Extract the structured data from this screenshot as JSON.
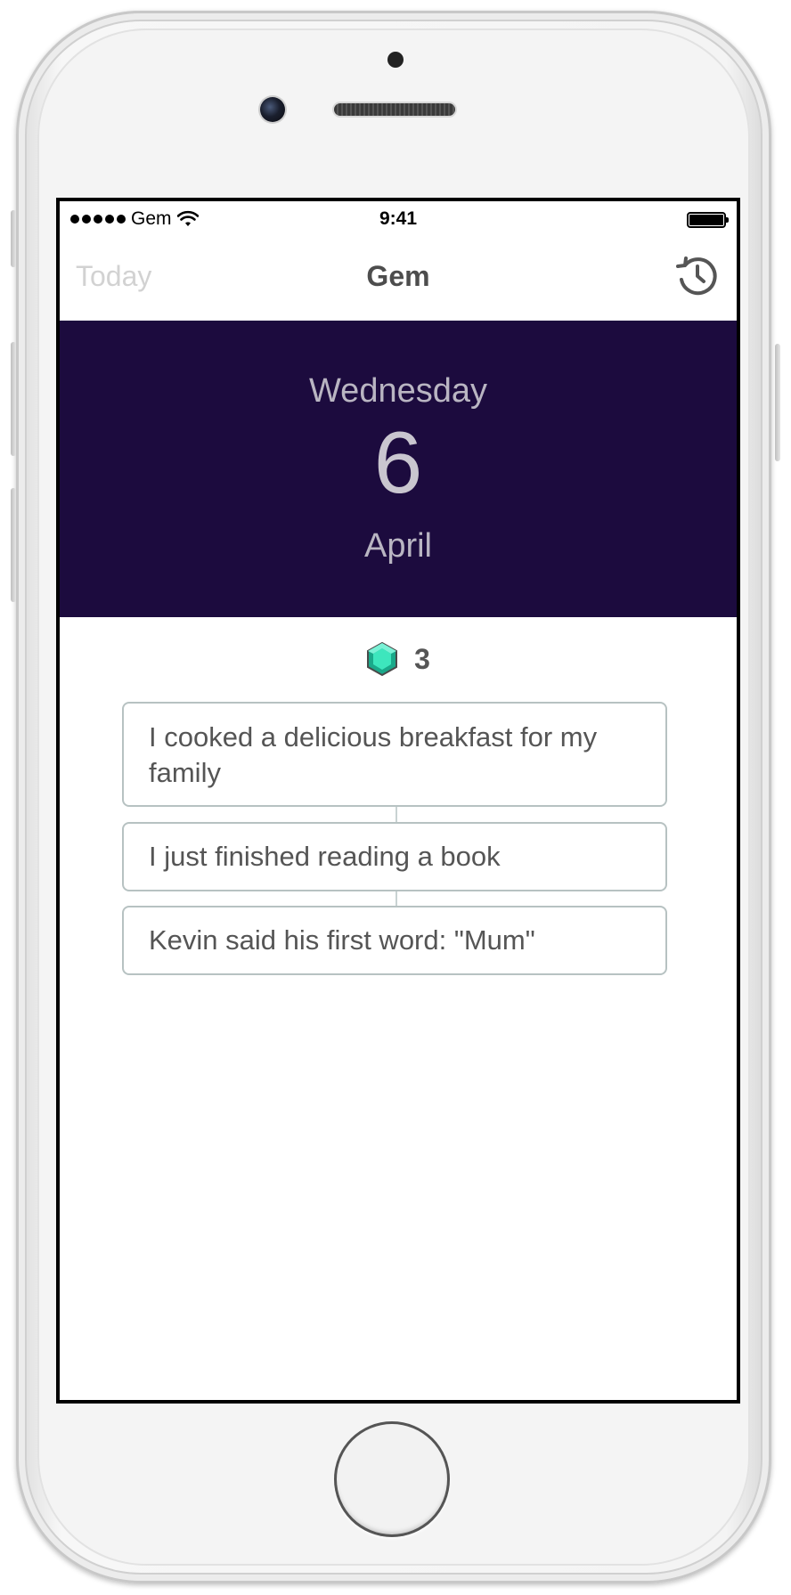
{
  "status_bar": {
    "carrier": "Gem",
    "time": "9:41",
    "battery_level": 1.0
  },
  "nav": {
    "left_label": "Today",
    "title": "Gem",
    "right_icon": "history-icon"
  },
  "date_header": {
    "weekday": "Wednesday",
    "day": "6",
    "month": "April",
    "background_color": "#1c0b3e"
  },
  "gem_summary": {
    "icon": "gem-icon",
    "count": "3",
    "gem_color": "#2fd8b0"
  },
  "entries": [
    {
      "text": "I cooked a delicious breakfast for my family"
    },
    {
      "text": "I just finished reading a book"
    },
    {
      "text": "Kevin said his first word: \"Mum\""
    }
  ]
}
